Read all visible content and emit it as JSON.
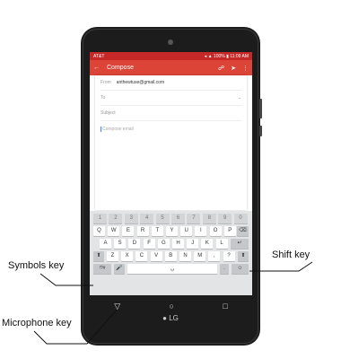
{
  "status_bar": {
    "carrier": "AT&T",
    "right": "◂ ▲ 100% ▮ 11:09 AM"
  },
  "app_bar": {
    "title": "Compose",
    "back_icon": "arrow-left-icon",
    "attach_icon": "paperclip-icon",
    "send_icon": "send-icon",
    "overflow_icon": "more-vert-icon"
  },
  "compose": {
    "from_label": "From",
    "from_value": "anthewtuse@gmail.com",
    "to_label": "To",
    "subject_placeholder": "Subject",
    "body_placeholder": "Compose email"
  },
  "keyboard": {
    "numbers": [
      "1",
      "2",
      "3",
      "4",
      "5",
      "6",
      "7",
      "8",
      "9",
      "0"
    ],
    "row1": [
      "Q",
      "W",
      "E",
      "R",
      "T",
      "Y",
      "U",
      "I",
      "O",
      "P"
    ],
    "row2": [
      "A",
      "S",
      "D",
      "F",
      "G",
      "H",
      "J",
      "K",
      "L"
    ],
    "row3": [
      "Z",
      "X",
      "C",
      "V",
      "B",
      "N",
      "M",
      ",",
      "?"
    ],
    "symbols_label": "!?#",
    "shift_icon": "shift-arrow-icon",
    "backspace_icon": "backspace-icon",
    "enter_icon": "enter-icon",
    "mic_icon": "microphone-icon",
    "period_label": "."
  },
  "navbar": {
    "back": "▽",
    "home": "○",
    "recents": "□"
  },
  "logo": "LG",
  "callouts": {
    "symbols": "Symbols key",
    "shift": "Shift key",
    "microphone": "Microphone key"
  }
}
